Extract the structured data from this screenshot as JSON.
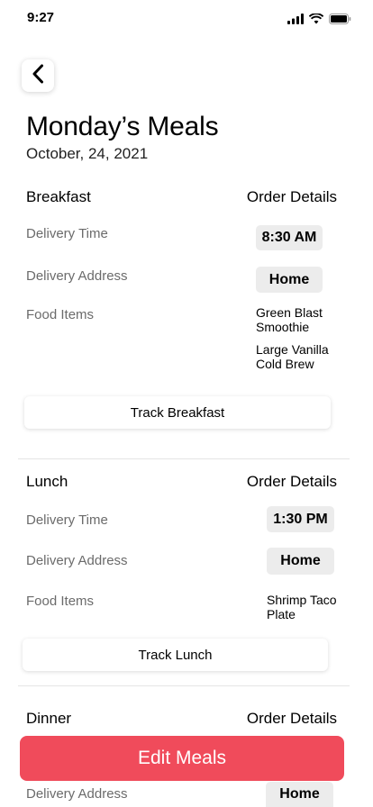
{
  "status_bar": {
    "time": "9:27"
  },
  "header": {
    "title": "Monday’s Meals",
    "date": "October, 24, 2021"
  },
  "breakfast": {
    "title": "Breakfast",
    "order_details": "Order Details",
    "delivery_time_label": "Delivery Time",
    "delivery_time": "8:30 AM",
    "delivery_address_label": "Delivery Address",
    "delivery_address": "Home",
    "food_items_label": "Food Items",
    "food_items": [
      "Green Blast Smoothie",
      "Large Vanilla Cold Brew"
    ],
    "track_label": "Track Breakfast"
  },
  "lunch": {
    "title": "Lunch",
    "order_details": "Order Details",
    "delivery_time_label": "Delivery Time",
    "delivery_time": "1:30 PM",
    "delivery_address_label": "Delivery Address",
    "delivery_address": "Home",
    "food_items_label": "Food Items",
    "food_items": [
      "Shrimp Taco Plate"
    ],
    "track_label": "Track Lunch"
  },
  "dinner": {
    "title": "Dinner",
    "order_details": "Order Details",
    "delivery_address_label": "Delivery Address",
    "delivery_address": "Home"
  },
  "footer": {
    "edit_label": "Edit Meals"
  }
}
